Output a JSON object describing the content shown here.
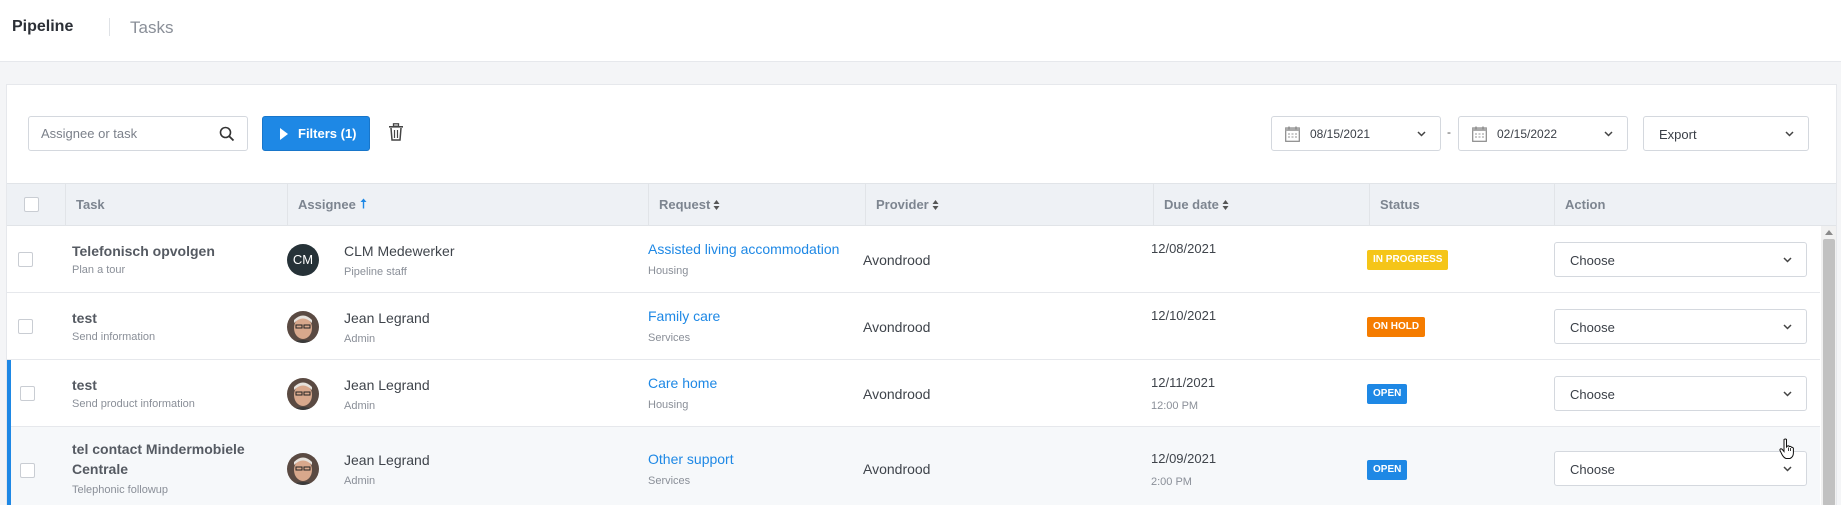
{
  "topbar": {
    "tab_pipeline": "Pipeline",
    "tab_tasks": "Tasks"
  },
  "toolbar": {
    "search_placeholder": "Assignee or task",
    "filters_label": "Filters (1)",
    "date_from": "08/15/2021",
    "date_separator": "-",
    "date_to": "02/15/2022",
    "export_label": "Export"
  },
  "table": {
    "headers": {
      "task": "Task",
      "assignee": "Assignee",
      "request": "Request",
      "provider": "Provider",
      "due_date": "Due date",
      "status": "Status",
      "action": "Action"
    },
    "rows": [
      {
        "task": "Telefonisch opvolgen",
        "task_sub": "Plan a tour",
        "avatar_initials": "CM",
        "assignee": "CLM Medewerker",
        "assignee_role": "Pipeline staff",
        "request": "Assisted living accommodation",
        "request_category": "Housing",
        "provider": "Avondrood",
        "due_date": "12/08/2021",
        "due_time": "",
        "status": "IN PROGRESS",
        "status_color": "#f5c518",
        "action": "Choose"
      },
      {
        "task": "test",
        "task_sub": "Send information",
        "avatar_initials": "",
        "assignee": "Jean Legrand",
        "assignee_role": "Admin",
        "request": "Family care",
        "request_category": "Services",
        "provider": "Avondrood",
        "due_date": "12/10/2021",
        "due_time": "",
        "status": "ON HOLD",
        "status_color": "#f57c00",
        "action": "Choose"
      },
      {
        "task": "test",
        "task_sub": "Send product information",
        "avatar_initials": "",
        "assignee": "Jean Legrand",
        "assignee_role": "Admin",
        "request": "Care home",
        "request_category": "Housing",
        "provider": "Avondrood",
        "due_date": "12/11/2021",
        "due_time": "12:00 PM",
        "status": "OPEN",
        "status_color": "#1e88e5",
        "action": "Choose"
      },
      {
        "task": "tel contact Mindermobiele Centrale",
        "task_sub": "Telephonic followup",
        "avatar_initials": "",
        "assignee": "Jean Legrand",
        "assignee_role": "Admin",
        "request": "Other support",
        "request_category": "Services",
        "provider": "Avondrood",
        "due_date": "12/09/2021",
        "due_time": "2:00 PM",
        "status": "OPEN",
        "status_color": "#1e88e5",
        "action": "Choose"
      }
    ]
  },
  "colors": {
    "accent": "#1e88e5",
    "header_bg": "#eef1f5"
  },
  "icons": [
    "search-icon",
    "play-icon",
    "trash-icon",
    "calendar-icon",
    "chevron-down-icon",
    "sort-icon",
    "sort-up-icon",
    "hand-cursor-icon"
  ]
}
